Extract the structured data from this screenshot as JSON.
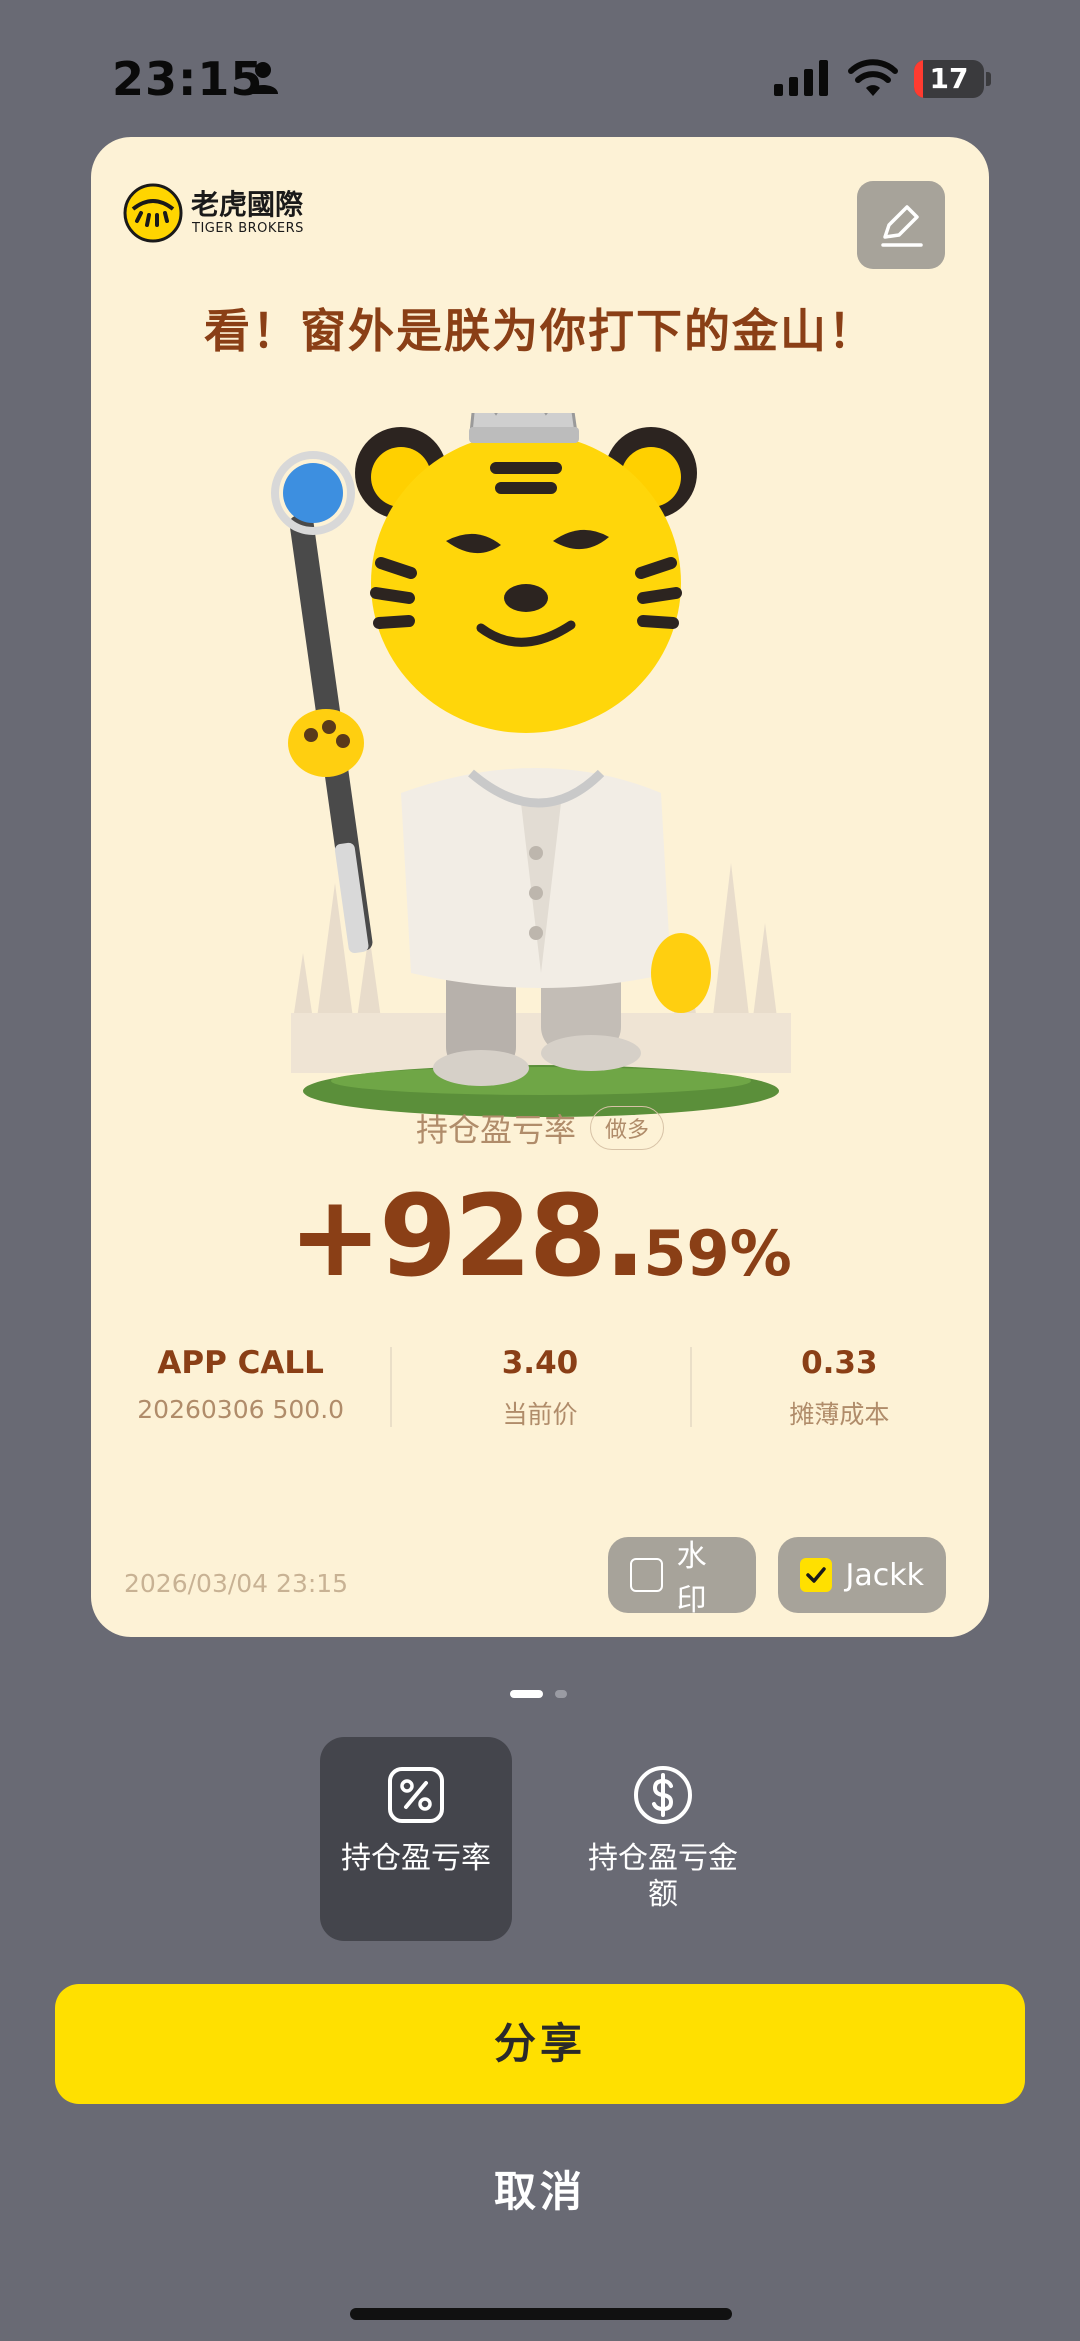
{
  "status_bar": {
    "time": "23:15",
    "battery": "17"
  },
  "card": {
    "brand_cn": "老虎國際",
    "brand_en": "TIGER BROKERS",
    "headline": "看！窗外是朕为你打下的金山！",
    "metric_label": "持仓盈亏率",
    "direction_badge": "做多",
    "return_int": "+928.",
    "return_dec": "59%",
    "stats": [
      {
        "value": "APP CALL",
        "label": "20260306  500.0"
      },
      {
        "value": "3.40",
        "label": "当前价"
      },
      {
        "value": "0.33",
        "label": "摊薄成本"
      }
    ],
    "date": "2026/03/04 23:15",
    "watermark_label": "水印",
    "watermark_checked": false,
    "name_label": "Jackk",
    "name_checked": true
  },
  "pager": {
    "total": 2,
    "active": 0
  },
  "options": [
    {
      "label": "持仓盈亏率",
      "icon": "percent-icon",
      "selected": true
    },
    {
      "label": "持仓盈亏金额",
      "icon": "dollar-icon",
      "selected": false
    }
  ],
  "share_label": "分享",
  "cancel_label": "取消",
  "colors": {
    "accent": "#ffe000",
    "brand_brown": "#8a3f16",
    "card_bg": "#fdf2d6",
    "backdrop": "#696a74"
  }
}
